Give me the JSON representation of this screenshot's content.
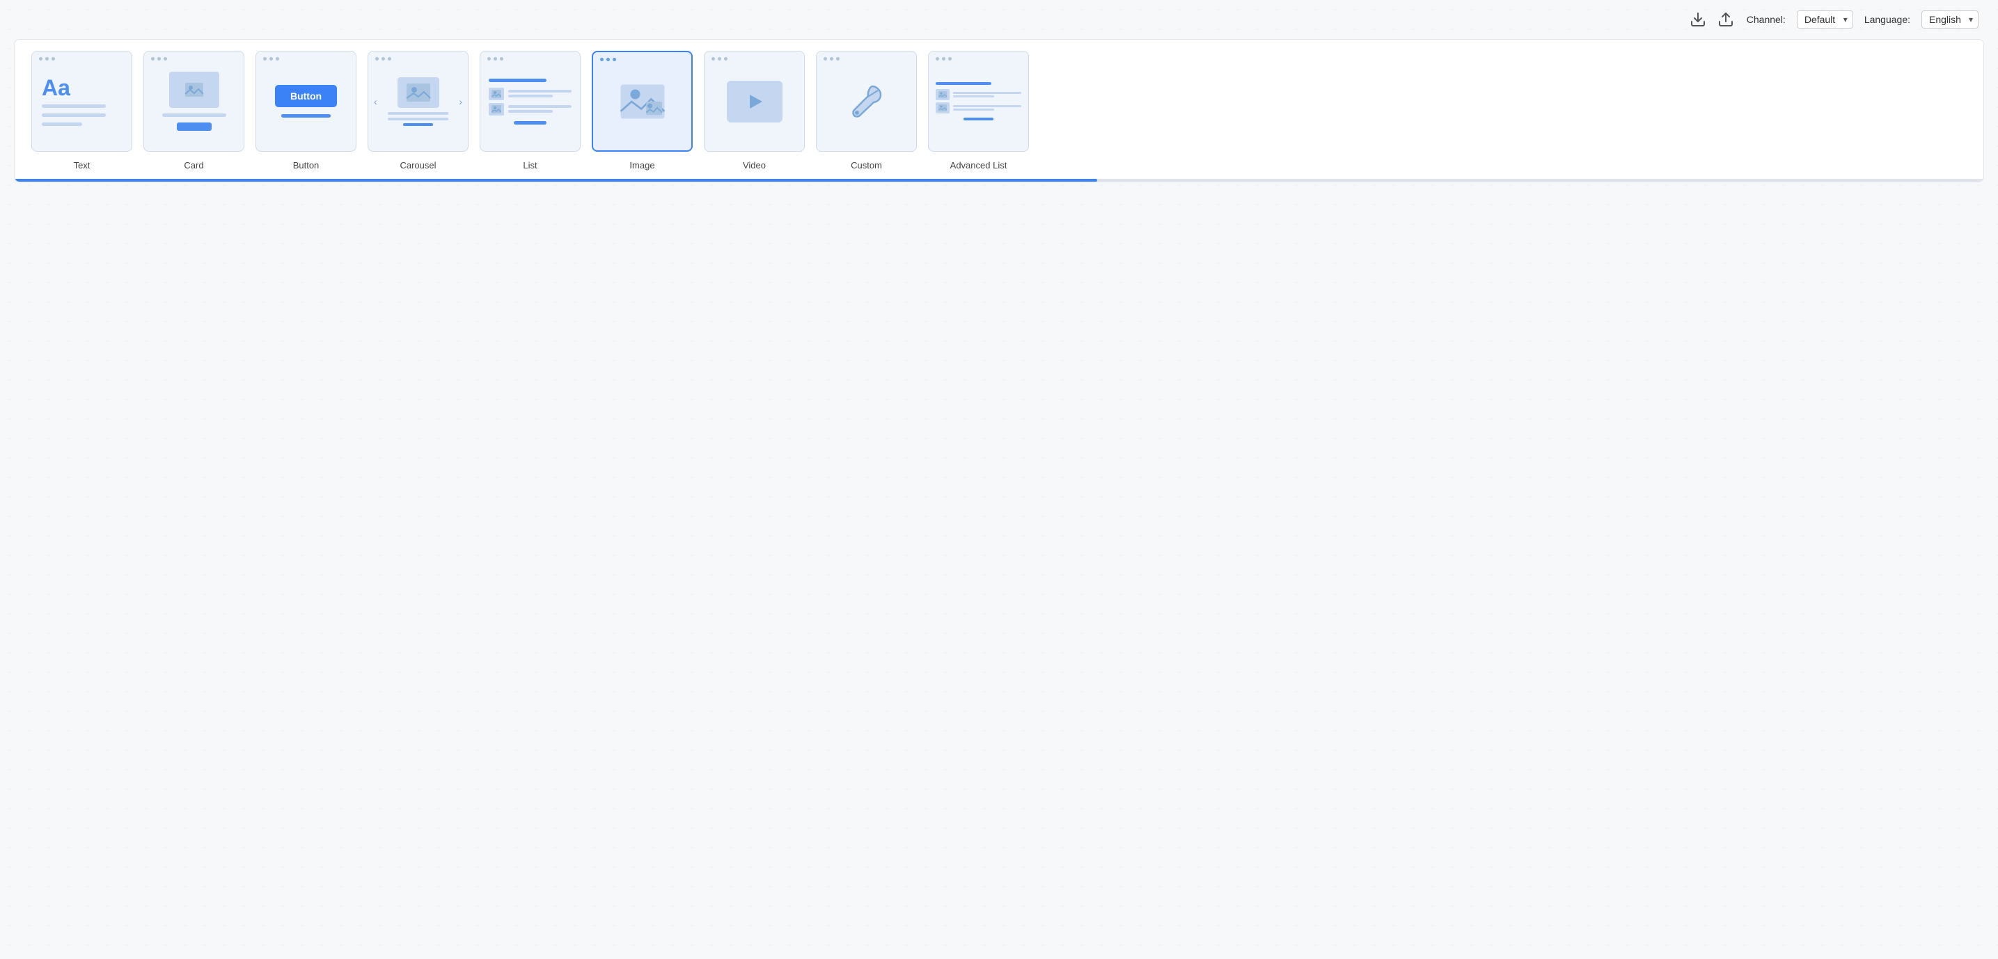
{
  "toolbar": {
    "download_label": "Download",
    "upload_label": "Upload",
    "channel_label": "Channel:",
    "channel_value": "Default",
    "language_label": "Language:",
    "language_value": "English",
    "channel_options": [
      "Default"
    ],
    "language_options": [
      "English"
    ]
  },
  "widgets": [
    {
      "id": "text",
      "label": "Text",
      "active": false
    },
    {
      "id": "card",
      "label": "Card",
      "active": false
    },
    {
      "id": "button",
      "label": "Button",
      "active": false
    },
    {
      "id": "carousel",
      "label": "Carousel",
      "active": false
    },
    {
      "id": "list",
      "label": "List",
      "active": false
    },
    {
      "id": "image",
      "label": "Image",
      "active": true,
      "tooltip": "image"
    },
    {
      "id": "video",
      "label": "Video",
      "active": false
    },
    {
      "id": "custom",
      "label": "Custom",
      "active": false
    },
    {
      "id": "advanced-list",
      "label": "Advanced List",
      "active": false
    }
  ],
  "colors": {
    "accent": "#3b82f6",
    "light_blue": "#c5d6f0",
    "bg": "#f7f8fa",
    "card_bg": "#f0f5fb"
  }
}
